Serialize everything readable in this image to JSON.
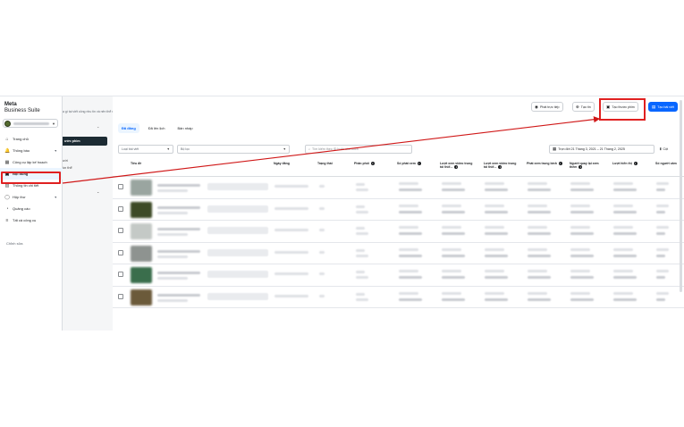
{
  "brand": {
    "line1": "Meta",
    "line2": "Business Suite"
  },
  "sidebar": {
    "items": [
      {
        "label": "Trang chủ",
        "icon": "home-icon",
        "glyph": "⌂"
      },
      {
        "label": "Thông báo",
        "icon": "bell-icon",
        "glyph": "🔔"
      },
      {
        "label": "Công cụ lập kế hoạch",
        "icon": "calendar-icon",
        "glyph": "▦"
      },
      {
        "label": "Nội dung",
        "icon": "content-icon",
        "glyph": "▣",
        "active": true
      },
      {
        "label": "Thông tin chi tiết",
        "icon": "chart-icon",
        "glyph": "▥"
      },
      {
        "label": "Hộp thư",
        "icon": "chat-icon",
        "glyph": "◯"
      },
      {
        "label": "Quảng cáo",
        "icon": "megaphone-icon",
        "glyph": "◔"
      },
      {
        "label": "Tất cả công cụ",
        "icon": "menu-icon",
        "glyph": "≡"
      }
    ],
    "edit": "Chỉnh sửa"
  },
  "subpanel": {
    "banner_fragment": "ạ gì tại viết công nhu tin và nên thể nữa.",
    "active": "ước phim",
    "items": [
      "ười",
      "ồn thể"
    ]
  },
  "topbar": {
    "live": "Phát trực tiếp",
    "story": "Tạo tin",
    "reel": "Tạo thước phim",
    "post": "Tạo bài viết"
  },
  "tabs": [
    "Đã đăng",
    "Đã lên lịch",
    "Bản nháp"
  ],
  "filters": {
    "post_type": "Loại bài viết",
    "status": "Bộ lọc",
    "search_placeholder": "Tìm kiếm theo ID hoặc chú thích",
    "date_range": "Trọn đời 21 Tháng 3, 2021 – 21 Tháng 2, 2025",
    "columns": "Cột",
    "date_icon": "calendar-icon"
  },
  "table": {
    "headers": {
      "title": "Tiêu đề",
      "date": "Ngày đăng",
      "status": "Trạng thái",
      "distribution": "Phân phối",
      "plays": "Số phát xem",
      "views_avg": "Lượt xem video trung tối thiể...",
      "views_full": "Lượt xem video trung tối thiể...",
      "watch_time": "Phát xem trung bình",
      "rewatch": "Người quay lại xem thêm",
      "reach": "Lượt hiển thị",
      "more": "Số người câm"
    },
    "row_count": 6
  },
  "colors": {
    "accent": "#0866ff",
    "highlight": "#e02020",
    "sidebar_active": "#ebf5ff"
  }
}
